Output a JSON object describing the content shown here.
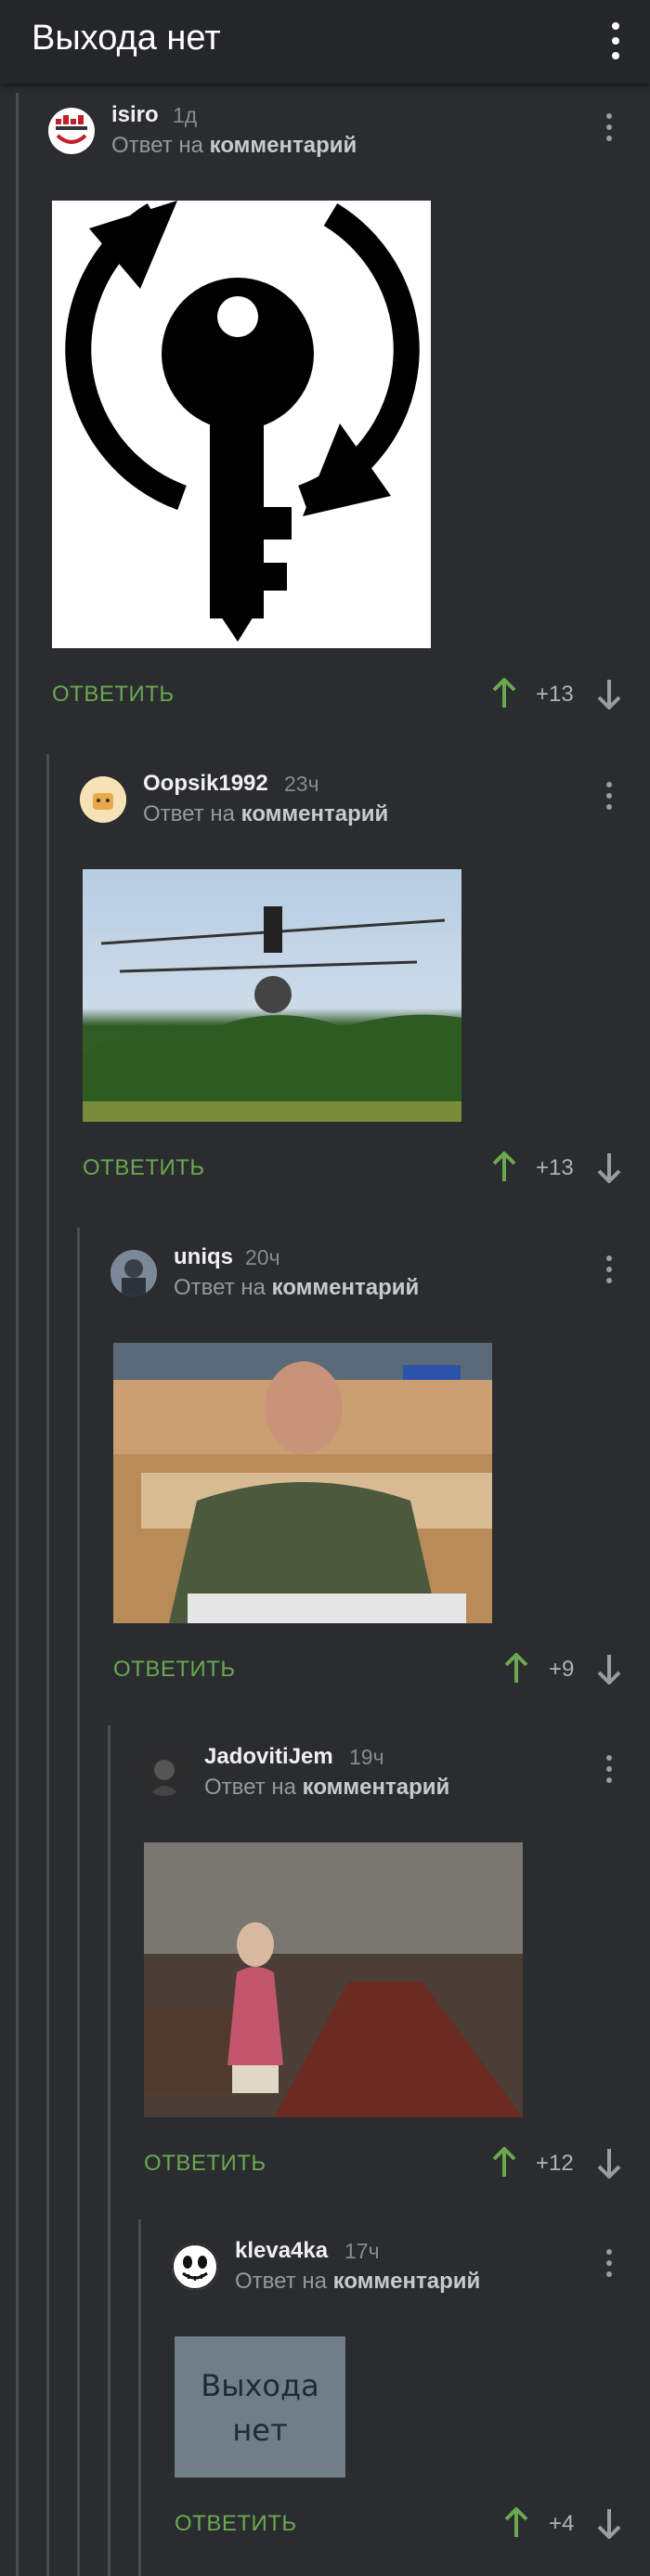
{
  "header": {
    "title": "Выхода нет"
  },
  "comments": [
    {
      "username": "isiro",
      "time": "1д",
      "reply_prefix": "Ответ на",
      "reply_link": "комментарий",
      "image_alt": "черный ключ с круговыми стрелками",
      "reply_label": "ОТВЕТИТЬ",
      "rating": "+13"
    },
    {
      "username": "Oopsik1992",
      "time": "23ч",
      "reply_prefix": "Ответ на",
      "reply_link": "комментарий",
      "image_alt": "человек на многороторном летательном аппарате над лесом",
      "reply_label": "ОТВЕТИТЬ",
      "rating": "+13"
    },
    {
      "username": "uniqs",
      "time": "20ч",
      "reply_prefix": "Ответ на",
      "reply_link": "комментарий",
      "image_alt": "мужчина в зеленой рубашке пишет за столом",
      "reply_label": "ОТВЕТИТЬ",
      "rating": "+9"
    },
    {
      "username": "JadovitiJem",
      "time": "19ч",
      "reply_prefix": "Ответ на",
      "reply_link": "комментарий",
      "image_alt": "женщина в вагоне метро",
      "reply_label": "ОТВЕТИТЬ",
      "rating": "+12"
    },
    {
      "username": "kleva4ka",
      "time": "17ч",
      "reply_prefix": "Ответ на",
      "reply_link": "комментарий",
      "image_text_line1": "Выхода",
      "image_text_line2": "нет",
      "reply_label": "ОТВЕТИТЬ",
      "rating": "+4"
    }
  ],
  "colors": {
    "accent_green": "#6aa84f",
    "background": "#2a2c30",
    "header": "#24262a"
  },
  "icons": [
    "kebab-menu-icon",
    "upvote-arrow-icon",
    "downvote-arrow-icon"
  ]
}
